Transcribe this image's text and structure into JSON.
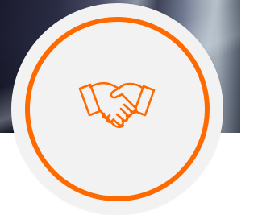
{
  "hero": {
    "image": "office-background-photo"
  },
  "badge": {
    "icon": "handshake-icon",
    "accent_color": "#ff6a00",
    "fill_color": "#f2f2f2"
  }
}
